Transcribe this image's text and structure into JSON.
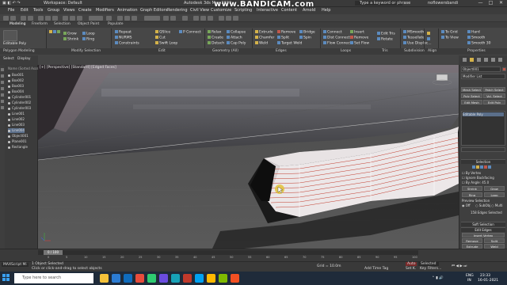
{
  "window": {
    "title_left": "Workspace: Default",
    "app_title": "Autodesk 3ds Max 2020",
    "search_placeholder": "Type a keyword or phrase",
    "user": "noflowersbandi",
    "controls": [
      "—",
      "□",
      "✕"
    ]
  },
  "watermark": "www.BANDICAM.com",
  "menubar": [
    "File",
    "Edit",
    "Tools",
    "Group",
    "Views",
    "Create",
    "Modifiers",
    "Animation",
    "Graph Editors",
    "Rendering",
    "Civil View",
    "Customize",
    "Scripting",
    "Interactive",
    "Content",
    "Arnold",
    "Help"
  ],
  "ribbon_tabs": [
    "Modeling",
    "Freeform",
    "Selection",
    "Object Paint",
    "Populate"
  ],
  "ribbon": {
    "polygon_modeling": [
      "Editable Poly",
      "Polygon Modeling"
    ],
    "modify_selection_col1": [
      "Grow",
      "Shrink"
    ],
    "modify_selection_col2": [
      "Loop",
      "Ring"
    ],
    "modify_selection_label": "Modify Selection",
    "edit_col1": [
      "Repeat",
      "NURMS",
      "Constraints"
    ],
    "edit_col2": [
      "QSlice",
      "Cut",
      "Swift Loop"
    ],
    "edit_col3": [
      "P Connect",
      "Attach",
      "Cap Poly"
    ],
    "edit_label": "Edit",
    "geometry_col1": [
      "Relax",
      "Create",
      "Detach"
    ],
    "geometry_col2": [
      "Collapse",
      "Cap Poly",
      "Cap Poly"
    ],
    "geometry_label": "Geometry (All)",
    "edges_col1": [
      "Extrude",
      "Chamfer",
      "Weld"
    ],
    "edges_col2": [
      "Remove",
      "Split",
      "Target Weld"
    ],
    "edges_col3": [
      "Bridge",
      "Spin",
      "Insert Vertex"
    ],
    "edges_label": "Edges",
    "loops_col1": [
      "Connect",
      "Dist Connect",
      "Flow Connect"
    ],
    "loops_col2": [
      "Insert",
      "Remove",
      "Set Flow"
    ],
    "loops_col3": [
      "Edit Tris",
      "Tri Alg",
      "Rotate"
    ],
    "loops_label": "Loops",
    "subdiv_col1": [
      "MSmooth",
      "Tessellate",
      "Use Displac..."
    ],
    "subdiv_label": "Subdivision",
    "align_col": [
      "Make Planar",
      "X Y Z"
    ],
    "align_label": "Align",
    "props_col1": [
      "Hard",
      "Smooth",
      "Smooth 30"
    ],
    "props_col2": [
      "To Grid",
      "To View"
    ],
    "props_label": "Properties",
    "footer": [
      "Polygon Modeling",
      "Modify Selection",
      "Edit",
      "Geometry (All)",
      "Edges",
      "Loops",
      "Tris",
      "Subdivision",
      "Align",
      "Properties"
    ]
  },
  "explorer": {
    "tabs": [
      "Select",
      "Display"
    ],
    "header": "Name (Sorted Ascen",
    "items": [
      "Box001",
      "Box002",
      "Box003",
      "Box004",
      "Cylinder001",
      "Cylinder002",
      "Cylinder003",
      "Line001",
      "Line002",
      "Line003",
      "Line004",
      "Object001",
      "Plane001",
      "Rectangle"
    ],
    "selected_index": 10
  },
  "viewport": {
    "label": "[+] [Perspective] [Standard] [Edged Faces]",
    "accent": "#e2c23a"
  },
  "command_panel": {
    "object_name": "Object001",
    "modifier_list": "Modifier List",
    "modifiers": [
      "Mesh Select",
      "Patch Select",
      "Poly Select",
      "Vol. Select",
      "Edit Mesh",
      "Edit Poly"
    ],
    "stack_item": "Editable Poly",
    "selection_head": "Selection",
    "by_vertex": "By Vertex",
    "ignore_backfacing": "Ignore Backfacing",
    "by_angle": "By Angle: 45.0",
    "shrink": "Shrink",
    "grow": "Grow",
    "ring": "Ring",
    "loop": "Loop",
    "preview_selection": "Preview Selection",
    "preview_opts": [
      "Off",
      "SubObj",
      "Multi"
    ],
    "status": "158 Edges Selected",
    "soft_head": "Soft Selection",
    "edit_edges_head": "Edit Edges",
    "insert_vertex": "Insert Vertex",
    "remove": "Remove",
    "split": "Split",
    "extrude": "Extrude",
    "weld": "Weld",
    "chamfer": "Chamfer",
    "target_weld": "Target Weld"
  },
  "timeline": {
    "frame": "0 / 100",
    "ticks": [
      "0",
      "5",
      "10",
      "15",
      "20",
      "25",
      "30",
      "35",
      "40",
      "45",
      "50",
      "55",
      "60",
      "65",
      "70",
      "75",
      "80",
      "85",
      "90",
      "95",
      "100"
    ]
  },
  "status": {
    "maxscript": "MAXScript Mi",
    "line1": "1 Object Selected",
    "line2": "Click or click-and-drag to select objects",
    "grid": "Grid = 10.0m",
    "time_tag": "Add Time Tag",
    "auto": "Auto",
    "selected": "Selected",
    "set_key": "Set K.",
    "filters": "Key Filters..."
  },
  "taskbar": {
    "search": "Type here to search",
    "apps": [
      "#f3c13a",
      "#2b7cd3",
      "#0f6cbd",
      "#e74c3c",
      "#2ecc71",
      "#6a4ce0",
      "#17a2b8",
      "#c0392b",
      "#00a1f1",
      "#ffb900",
      "#7fba00",
      "#f25022"
    ],
    "tray_lang": "ENG",
    "tray_region": "IN",
    "time": "23:33",
    "date": "16-01-2021"
  }
}
